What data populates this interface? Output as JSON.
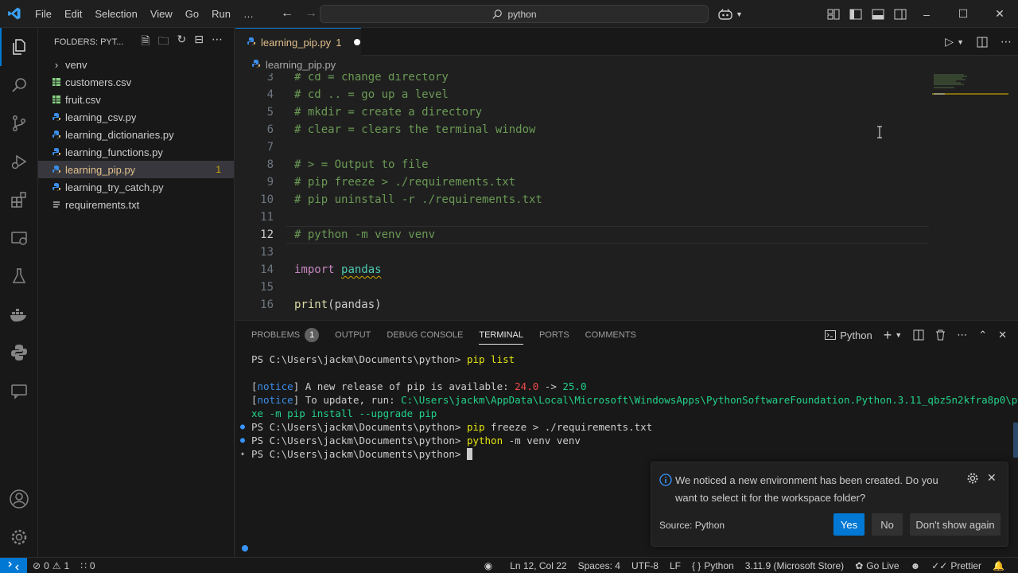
{
  "titlebar": {
    "menu": [
      "File",
      "Edit",
      "Selection",
      "View",
      "Go",
      "Run",
      "…"
    ],
    "search_text": "python",
    "window_controls": [
      "minimize-icon",
      "restore-icon",
      "close-icon"
    ]
  },
  "activitybar": {
    "items": [
      "explorer-icon",
      "search-icon",
      "source-control-icon",
      "run-debug-icon",
      "extensions-icon",
      "remote-explorer-icon",
      "testing-icon",
      "docker-icon",
      "python-icon",
      "chat-icon"
    ],
    "bottom": [
      "account-icon",
      "settings-gear-icon"
    ]
  },
  "sidebar": {
    "header": "FOLDERS: PYT...",
    "items": [
      {
        "label": "venv",
        "icon": "chevron-right-icon"
      },
      {
        "label": "customers.csv",
        "icon": "csv-file-icon"
      },
      {
        "label": "fruit.csv",
        "icon": "csv-file-icon"
      },
      {
        "label": "learning_csv.py",
        "icon": "python-file-icon"
      },
      {
        "label": "learning_dictionaries.py",
        "icon": "python-file-icon"
      },
      {
        "label": "learning_functions.py",
        "icon": "python-file-icon"
      },
      {
        "label": "learning_pip.py",
        "icon": "python-file-icon",
        "badge": "1",
        "selected": true
      },
      {
        "label": "learning_try_catch.py",
        "icon": "python-file-icon"
      },
      {
        "label": "requirements.txt",
        "icon": "text-file-icon"
      }
    ]
  },
  "editor": {
    "tab_label": "learning_pip.py",
    "tab_problems": "1",
    "breadcrumb": "learning_pip.py",
    "lines": [
      {
        "n": "3",
        "text": "# cd = change directory"
      },
      {
        "n": "4",
        "text": "# cd .. = go up a level"
      },
      {
        "n": "5",
        "text": "# mkdir = create a directory"
      },
      {
        "n": "6",
        "text": "# clear = clears the terminal window"
      },
      {
        "n": "7",
        "text": ""
      },
      {
        "n": "8",
        "text": "# > = Output to file"
      },
      {
        "n": "9",
        "text": "# pip freeze > ./requirements.txt"
      },
      {
        "n": "10",
        "text": "# pip uninstall -r ./requirements.txt"
      },
      {
        "n": "11",
        "text": ""
      },
      {
        "n": "12",
        "text": "# python -m venv venv"
      },
      {
        "n": "13",
        "text": ""
      },
      {
        "n": "14",
        "kw": "import",
        "id": "pandas"
      },
      {
        "n": "15",
        "text": ""
      },
      {
        "n": "16",
        "fn": "print",
        "arg": "pandas"
      }
    ]
  },
  "panel": {
    "tabs": [
      "PROBLEMS",
      "OUTPUT",
      "DEBUG CONSOLE",
      "TERMINAL",
      "PORTS",
      "COMMENTS"
    ],
    "problems_count": "1",
    "terminal_name": "Python",
    "terminal": {
      "prompt": "PS C:\\Users\\jackm\\Documents\\python>",
      "l1_cmd": "pip list",
      "notice_tag": "notice",
      "notice1_text": " A new release of pip is available: ",
      "old_ver": "24.0",
      "arrow": " -> ",
      "new_ver": "25.0",
      "notice2_text": " To update, run: ",
      "notice2_path": "C:\\Users\\jackm\\AppData\\Local\\Microsoft\\WindowsApps\\PythonSoftwareFoundation.Python.3.11_qbz5n2kfra8p0\\python.e",
      "notice2_cont": "xe -m pip install --upgrade pip",
      "l4_cmd_a": "pip",
      "l4_cmd_b": " freeze > ./requirements.txt",
      "l5_cmd_a": "python",
      "l5_cmd_b": " -m venv venv"
    }
  },
  "notification": {
    "message": "We noticed a new environment has been created. Do you want to select it for the workspace folder?",
    "source": "Source: Python",
    "yes": "Yes",
    "no": "No",
    "dont_show": "Don't show again"
  },
  "statusbar": {
    "errors": "0",
    "warnings": "1",
    "ports": "0",
    "position": "Ln 12, Col 22",
    "spaces": "Spaces: 4",
    "encoding": "UTF-8",
    "eol": "LF",
    "language": "Python",
    "interpreter": "3.11.9 (Microsoft Store)",
    "golive": "Go Live",
    "prettier": "Prettier"
  },
  "colors": {
    "accent": "#0078d4",
    "modified": "#e2c08d",
    "comment": "#6a9955",
    "keyword": "#c586c0"
  }
}
